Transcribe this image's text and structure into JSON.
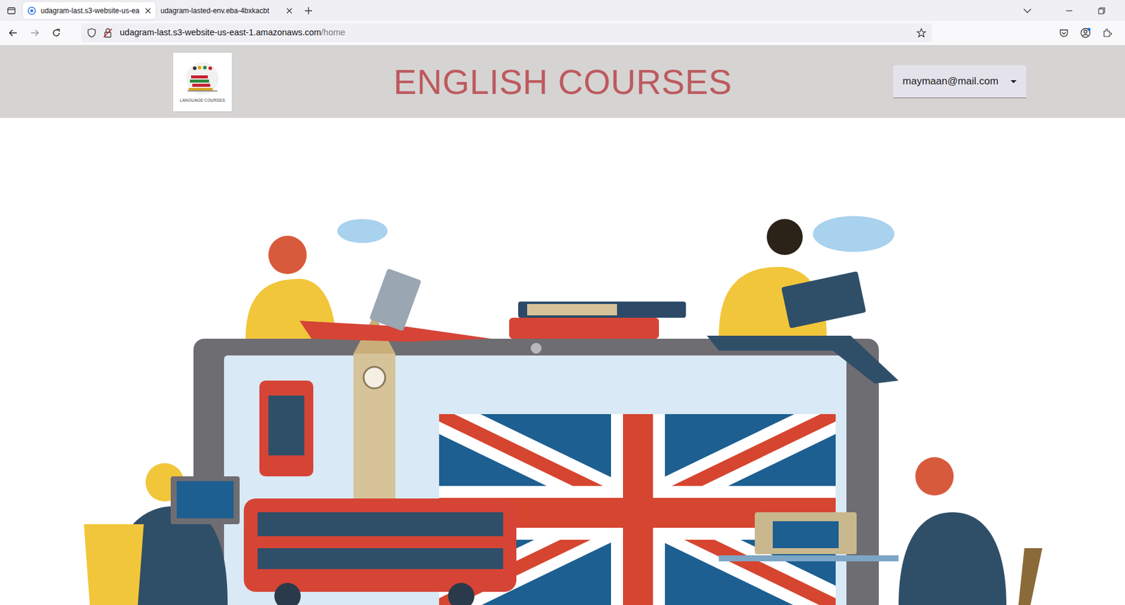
{
  "browser": {
    "tabs": [
      {
        "label": "udagram-last.s3-website-us-ea",
        "selected": true
      },
      {
        "label": "udagram-lasted-env.eba-4bxkacbt",
        "selected": false
      }
    ],
    "address": {
      "host": "udagram-last.s3-website-us-east-1.amazonaws.com",
      "path": "/home"
    }
  },
  "page": {
    "logo_caption": "LANGUAGE COURSES",
    "title": "ENGLISH COURSES",
    "user_menu": {
      "label": "maymaan@mail.com"
    }
  }
}
